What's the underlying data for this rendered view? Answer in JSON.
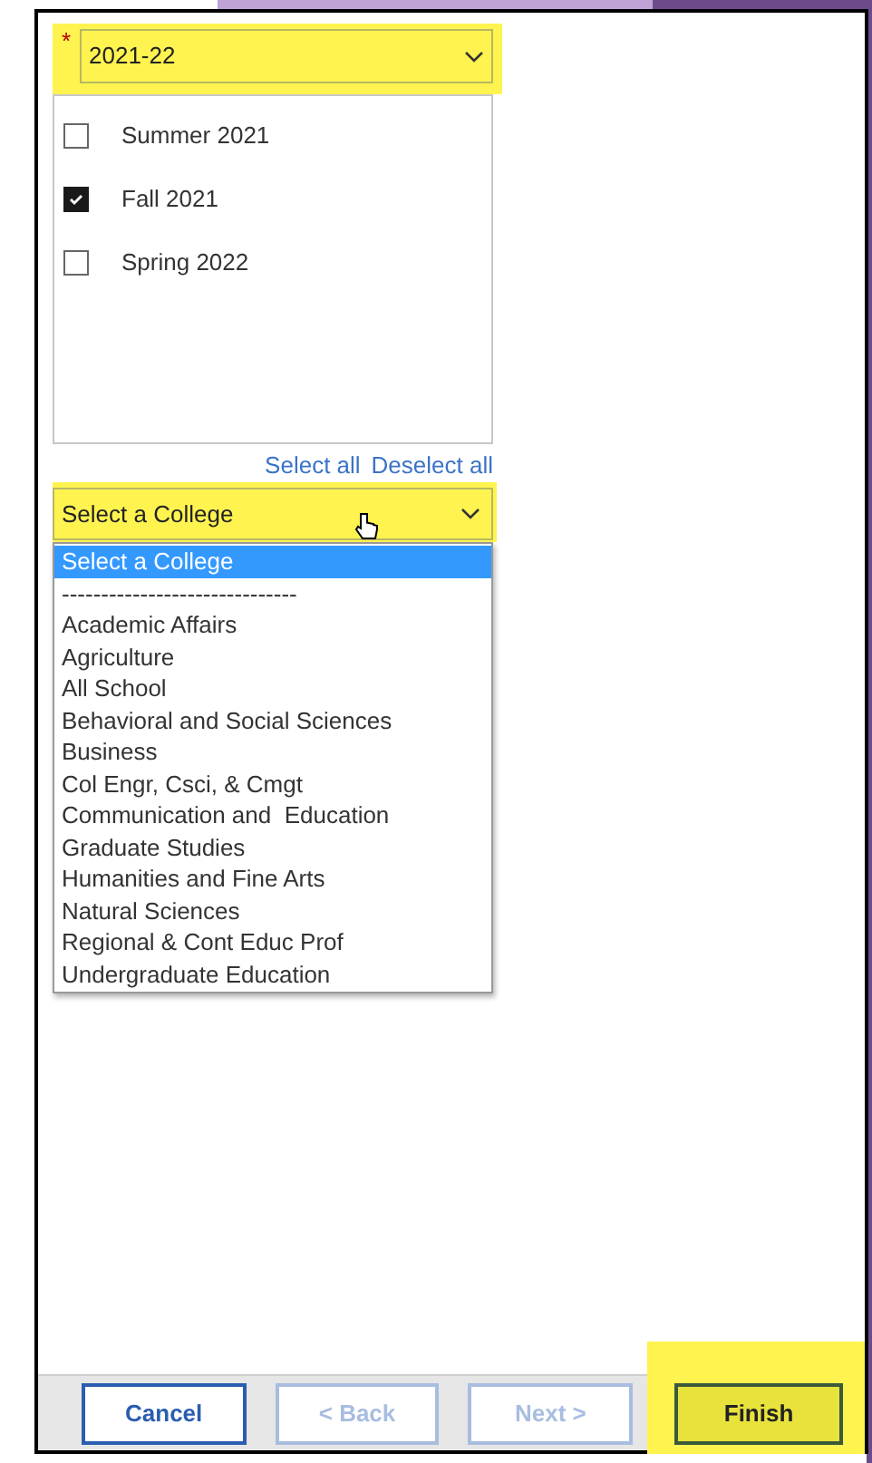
{
  "year_select": {
    "value": "2021-22",
    "required_mark": "*",
    "highlighted": true
  },
  "terms": [
    {
      "label": "Summer 2021",
      "checked": false
    },
    {
      "label": "Fall 2021",
      "checked": true
    },
    {
      "label": "Spring 2022",
      "checked": false
    }
  ],
  "links": [
    "Select all",
    "Deselect all"
  ],
  "college_select": {
    "value": "Select a College",
    "highlighted": true,
    "expanded": true
  },
  "college_options": [
    {
      "label": "Select a College",
      "selected": true
    },
    {
      "label": "------------------------------",
      "selected": false
    },
    {
      "label": "Academic Affairs",
      "selected": false
    },
    {
      "label": "Agriculture",
      "selected": false
    },
    {
      "label": "All School",
      "selected": false
    },
    {
      "label": "Behavioral and Social Sciences",
      "selected": false
    },
    {
      "label": "Business",
      "selected": false
    },
    {
      "label": "Col Engr, Csci, & Cmgt",
      "selected": false
    },
    {
      "label": "Communication and  Education",
      "selected": false
    },
    {
      "label": "Graduate Studies",
      "selected": false
    },
    {
      "label": "Humanities and Fine Arts",
      "selected": false
    },
    {
      "label": "Natural Sciences",
      "selected": false
    },
    {
      "label": "Regional & Cont Educ Prof",
      "selected": false
    },
    {
      "label": "Undergraduate Education",
      "selected": false
    }
  ],
  "buttons": [
    {
      "label": "Cancel",
      "disabled": false,
      "highlighted": false
    },
    {
      "label": "< Back",
      "disabled": true,
      "highlighted": false
    },
    {
      "label": "Next >",
      "disabled": true,
      "highlighted": false
    },
    {
      "label": "Finish",
      "disabled": false,
      "highlighted": true
    }
  ]
}
